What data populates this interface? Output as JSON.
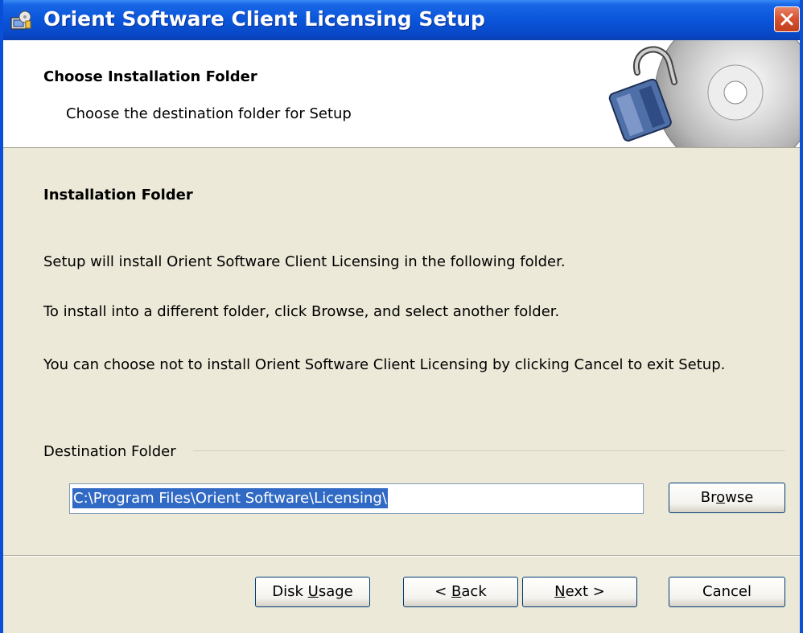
{
  "window": {
    "title": "Orient Software Client Licensing Setup"
  },
  "banner": {
    "title": "Choose Installation Folder",
    "subtitle": "Choose the destination folder for Setup"
  },
  "content": {
    "heading": "Installation Folder",
    "para1": "Setup will install Orient Software Client Licensing in the following folder.",
    "para2": "To install into a different folder, click Browse, and select another folder.",
    "para3": "You can choose not to install Orient Software Client Licensing by clicking Cancel to exit Setup."
  },
  "destination": {
    "group_label": "Destination Folder",
    "path_value": "C:\\Program Files\\Orient Software\\Licensing\\",
    "browse": {
      "pre": "Br",
      "mnemonic": "o",
      "post": "wse"
    }
  },
  "buttons": {
    "disk_usage": {
      "pre": "Disk ",
      "mnemonic": "U",
      "post": "sage"
    },
    "back": {
      "pre": "< ",
      "mnemonic": "B",
      "post": "ack"
    },
    "next": {
      "pre": "",
      "mnemonic": "N",
      "post": "ext >"
    },
    "cancel": "Cancel"
  },
  "colors": {
    "titlebar": "#0A55DA",
    "close_button": "#D8532F",
    "dialog_face": "#ECE9D8",
    "selection": "#316AC5"
  },
  "icons": {
    "title_icon": "installer-icon",
    "close_icon": "close-icon",
    "banner_art": "cd-padlock-icon"
  }
}
